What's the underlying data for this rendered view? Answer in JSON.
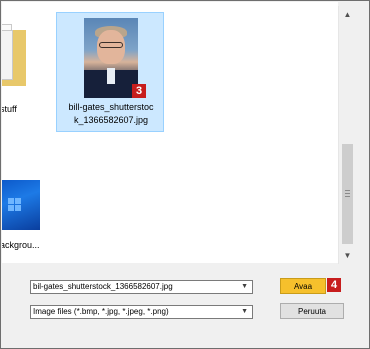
{
  "files": [
    {
      "name": "stuff",
      "kind": "folder",
      "selected": false
    },
    {
      "name": "bill-gates_shutterstock_1366582607.jpg",
      "label_line1": "bill-gates_shutterstoc",
      "label_line2": "k_1366582607.jpg",
      "kind": "image",
      "selected": true,
      "step_badge": "3"
    },
    {
      "name": "ackgrou...",
      "kind": "image",
      "selected": false
    }
  ],
  "file_name_field": {
    "value": "bil-gates_shutterstock_1366582607.jpg"
  },
  "file_type_filter": {
    "value": "Image files (*.bmp, *.jpg, *.jpeg, *.png)"
  },
  "buttons": {
    "open": "Avaa",
    "open_step_badge": "4",
    "cancel": "Peruuta"
  },
  "colors": {
    "selection_bg": "#cce8ff",
    "badge": "#c71d1d",
    "open_button": "#f6c02c"
  }
}
